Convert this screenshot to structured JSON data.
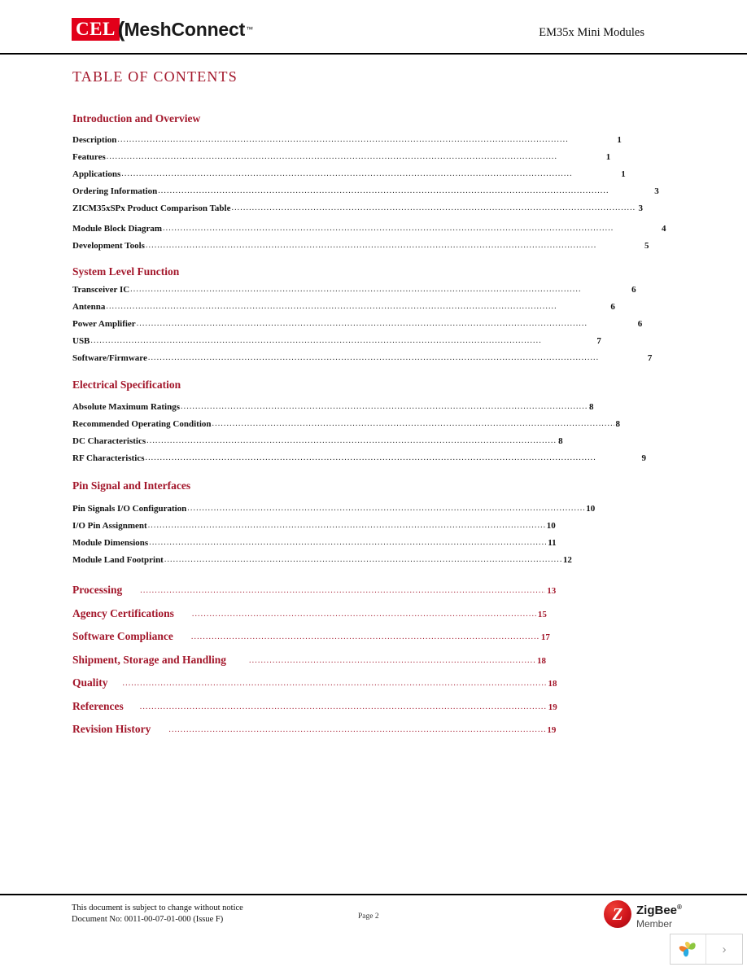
{
  "header": {
    "logo": {
      "brand_mark": "CEL",
      "brand_name": "MeshConnect",
      "trademark": "™"
    },
    "document_title": "EM35x Mini Modules"
  },
  "toc": {
    "title": "TABLE OF CONTENTS",
    "sections": [
      {
        "heading": "Introduction and Overview",
        "entries": [
          {
            "label": "Description",
            "page": "1",
            "leader_width": 612,
            "level": 1
          },
          {
            "label": "Features",
            "page": "1",
            "leader_width": 612,
            "level": 1
          },
          {
            "label": "Applications",
            "page": "1",
            "leader_width": 612,
            "level": 1
          },
          {
            "label": "Ordering Information",
            "page": "3",
            "leader_width": 608,
            "level": 1
          },
          {
            "label": "ZICM35xSPx Product Comparison Table",
            "page": "3",
            "leader_width": 498,
            "level": 2
          },
          {
            "label": "Module Block Diagram",
            "page": "4",
            "leader_width": 611,
            "level": 1
          },
          {
            "label": "Development Tools",
            "page": "5",
            "leader_width": 611,
            "level": 1
          }
        ]
      },
      {
        "heading": "System Level Function",
        "entries": [
          {
            "label": "Transceiver IC",
            "page": "6",
            "leader_width": 614,
            "level": 1
          },
          {
            "label": "Antenna",
            "page": "6",
            "leader_width": 618,
            "level": 1
          },
          {
            "label": "Power Amplifier",
            "page": "6",
            "leader_width": 614,
            "level": 1
          },
          {
            "label": "USB",
            "page": "7",
            "leader_width": 620,
            "level": 1
          },
          {
            "label": "Software/Firmware",
            "page": "7",
            "leader_width": 612,
            "level": 1
          }
        ]
      },
      {
        "heading": "Electrical Specification",
        "entries": [
          {
            "label": "Absolute Maximum Ratings",
            "page": "8",
            "leader_width": 603,
            "level": 1
          },
          {
            "label": "Recommended Operating Condition",
            "page": "8",
            "leader_width": 597,
            "level": 1
          },
          {
            "label": "DC Characteristics",
            "page": "8",
            "leader_width": 607,
            "level": 1
          },
          {
            "label": "RF Characteristics",
            "page": "9",
            "leader_width": 608,
            "level": 1
          }
        ]
      },
      {
        "heading": "Pin Signal and Interfaces",
        "entries": [
          {
            "label": "Pin Signals I/O Configuration",
            "page": "10",
            "leader_width": 594,
            "level": 1
          },
          {
            "label": "I/O Pin Assignment",
            "page": "10",
            "leader_width": 594,
            "level": 1
          },
          {
            "label": "Module Dimensions",
            "page": "11",
            "leader_width": 594,
            "level": 1
          },
          {
            "label": "Module Land Footprint",
            "page": "12",
            "leader_width": 594,
            "level": 1
          }
        ]
      }
    ],
    "top_level_entries": [
      {
        "label": "Processing",
        "page": "13",
        "leader_width": 498
      },
      {
        "label": "Agency Certifications",
        "page": "15",
        "leader_width": 423
      },
      {
        "label": "Software Compliance",
        "page": "17",
        "leader_width": 428
      },
      {
        "label": "Shipment, Storage and Handling",
        "page": "18",
        "leader_width": 352
      },
      {
        "label": "Quality",
        "page": "18",
        "leader_width": 521
      },
      {
        "label": "References",
        "page": "19",
        "leader_width": 500
      },
      {
        "label": "Revision History",
        "page": "19",
        "leader_width": 463
      }
    ]
  },
  "footer": {
    "disclaimer": "This document is subject to change without notice",
    "document_no": "Document No: 0011-00-07-01-000 (Issue F)",
    "page_label": "Page 2",
    "zigbee": {
      "glyph": "Z",
      "name": "ZigBee",
      "registered": "®",
      "member": "Member"
    }
  },
  "overlay_widget": {
    "next_glyph": "›"
  },
  "colors": {
    "heading_red": "#A3172B",
    "logo_red": "#E2001A",
    "rule_black": "#000000"
  }
}
